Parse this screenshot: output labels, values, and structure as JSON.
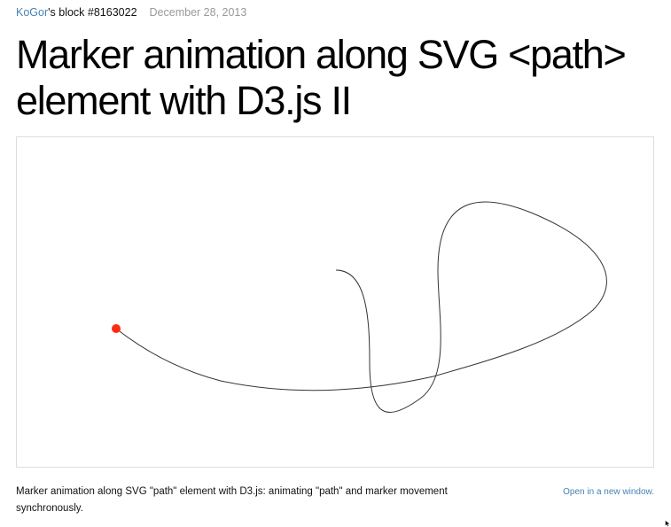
{
  "header": {
    "author_link": "KoGor",
    "block_suffix": "'s block #8163022",
    "date": "December 28, 2013"
  },
  "page": {
    "title": "Marker animation along SVG <path> element with D3.js II"
  },
  "demo": {
    "path_color": "#333333",
    "marker_color": "#ff2a12"
  },
  "footer": {
    "description": "Marker animation along SVG \"path\" element with D3.js: animating \"path\" and marker movement synchronously.",
    "open_link": "Open in a new window."
  },
  "icons": {
    "cursor": "mouse-pointer-icon"
  }
}
